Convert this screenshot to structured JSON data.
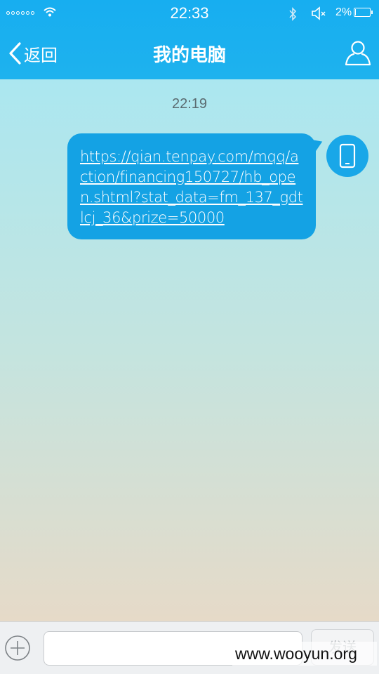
{
  "status_bar": {
    "time": "22:33",
    "battery_percent": "2%",
    "battery_level": 0.02,
    "icons": [
      "signal-dots-icon",
      "wifi-icon",
      "bluetooth-icon",
      "mute-icon",
      "battery-icon"
    ]
  },
  "nav": {
    "back_label": "返回",
    "title": "我的电脑",
    "icons": [
      "chevron-left-icon",
      "user-profile-icon"
    ]
  },
  "chat": {
    "timestamp": "22:19",
    "messages": [
      {
        "direction": "outgoing",
        "text": "https://qian.tenpay.com/mqq/action/financing150727/hb_open.shtml?stat_data=fm_137_gdtlcj_36&prize=50000",
        "avatar_icon": "phone-icon"
      }
    ]
  },
  "input_bar": {
    "plus_icon": "plus-circle-icon",
    "input_value": "",
    "send_label": "发送"
  },
  "watermark": "www.wooyun.org",
  "colors": {
    "header": "#1eb2ee",
    "bubble": "#14a2e4",
    "chat_bg_top": "#abe7f0",
    "chat_bg_bottom": "#e6dac8"
  }
}
